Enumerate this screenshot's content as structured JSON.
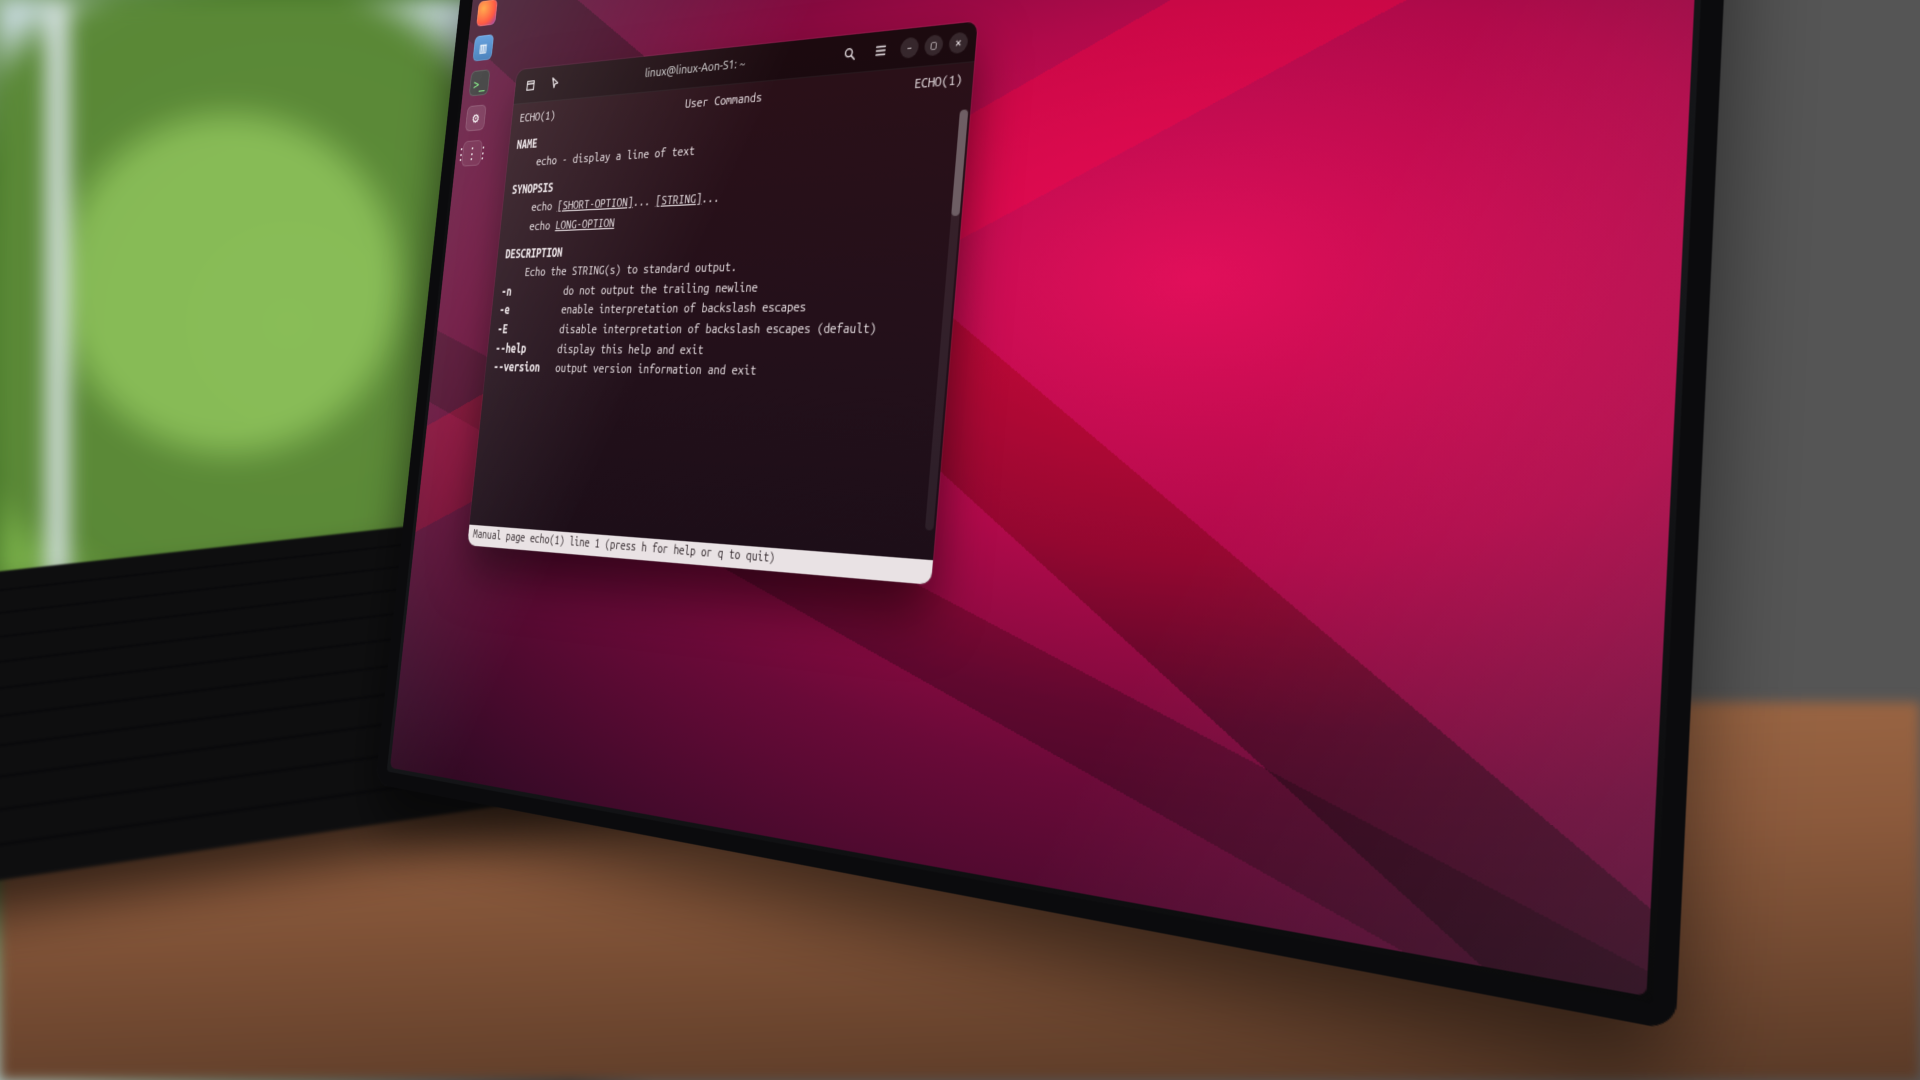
{
  "dock": {
    "items": [
      "firefox-icon",
      "files-icon",
      "terminal-icon",
      "settings-icon",
      "apps-icon"
    ]
  },
  "terminal": {
    "title": "linux@linux-Aon-S1: ~",
    "header_left": "ECHO(1)",
    "header_center": "User Commands",
    "header_right": "ECHO(1)",
    "section_name": "NAME",
    "name_line": "echo - display a line of text",
    "section_synopsis": "SYNOPSIS",
    "syn1_a": "echo ",
    "syn1_b": "[SHORT-OPTION]",
    "syn1_c": "... ",
    "syn1_d": "[STRING]",
    "syn1_e": "...",
    "syn2_a": "echo ",
    "syn2_b": "LONG-OPTION",
    "section_description": "DESCRIPTION",
    "desc_intro": "Echo the STRING(s) to standard output.",
    "opts": [
      {
        "flag": "-n",
        "text": "do not output the trailing newline"
      },
      {
        "flag": "-e",
        "text": "enable interpretation of backslash escapes"
      },
      {
        "flag": "-E",
        "text": "disable interpretation of backslash escapes (default)"
      },
      {
        "flag": "--help",
        "text": "display this help and exit"
      },
      {
        "flag": "--version",
        "text": "output version information and exit"
      }
    ],
    "status": "Manual page echo(1) line 1 (press h for help or q to quit)"
  }
}
